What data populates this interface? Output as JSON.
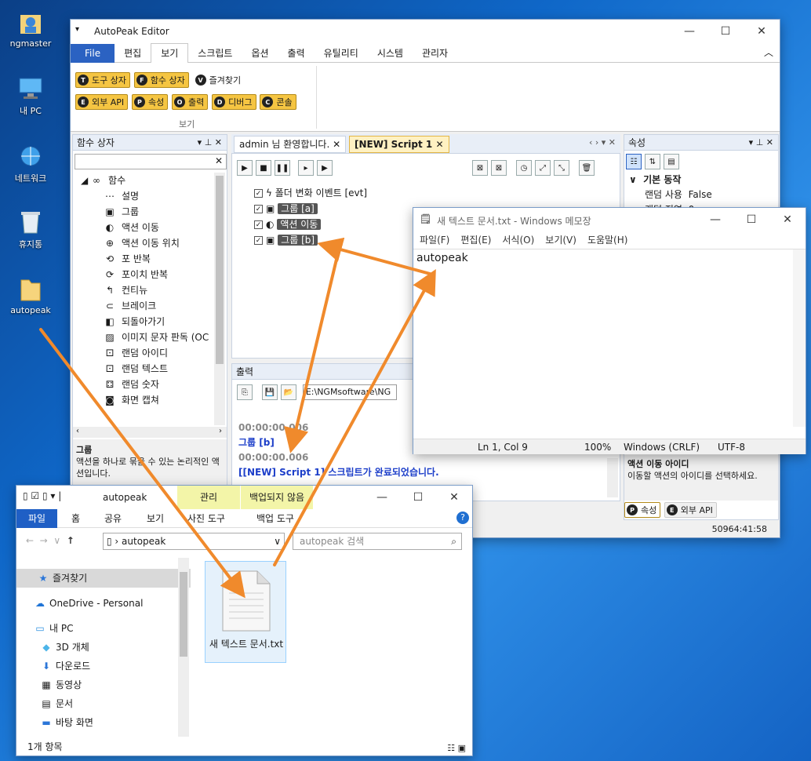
{
  "desktop": {
    "icons": [
      "ngmaster",
      "내 PC",
      "네트워크",
      "휴지통",
      "autopeak"
    ]
  },
  "autopeak": {
    "title": "AutoPeak Editor",
    "menu": [
      "File",
      "편집",
      "보기",
      "스크립트",
      "옵션",
      "출력",
      "유틸리티",
      "시스템",
      "관리자"
    ],
    "ribbon": {
      "row1": [
        {
          "k": "T",
          "t": "도구 상자"
        },
        {
          "k": "F",
          "t": "함수 상자"
        },
        {
          "k": "V",
          "t": "즐겨찾기"
        }
      ],
      "row2": [
        {
          "k": "E",
          "t": "외부 API"
        },
        {
          "k": "P",
          "t": "속성"
        },
        {
          "k": "O",
          "t": "출력"
        },
        {
          "k": "D",
          "t": "디버그"
        },
        {
          "k": "C",
          "t": "콘솔"
        }
      ],
      "group": "보기"
    },
    "func_box": {
      "title": "함수 상자",
      "root": "함수",
      "items": [
        "설명",
        "그룹",
        "액션 이동",
        "액션 이동 위치",
        "포 반복",
        "포이치 반복",
        "컨티뉴",
        "브레이크",
        "되돌아가기",
        "이미지 문자 판독 (OC",
        "랜덤 아이디",
        "랜덤 텍스트",
        "랜덤 숫자",
        "화면 캡쳐"
      ],
      "desc_title": "그룹",
      "desc": "액션을 하나로 묶을 수 있는 논리적인 액션입니다."
    },
    "tabs": [
      "admin 님 환영합니다.",
      "[NEW] Script 1"
    ],
    "script": [
      {
        "t": "폴더 변화 이벤트 [evt]",
        "tag": false
      },
      {
        "t": "그룹 [a]",
        "tag": true
      },
      {
        "t": "액션 이동",
        "tag": true
      },
      {
        "t": "그룹 [b]",
        "tag": true
      }
    ],
    "output": {
      "title": "출력",
      "path": "E:\\NGMsoftware\\NG",
      "lines": [
        "00:00:00.006",
        "그룹 [b]",
        "00:00:00.006",
        "[[NEW] Script 1] 스크립트가 완료되었습니다."
      ]
    },
    "props": {
      "title": "속성",
      "section": "기본 동작",
      "rows": [
        {
          "k": "랜덤 사용",
          "v": "False"
        },
        {
          "k": "랜덤 지연",
          "v": "0"
        }
      ],
      "desc_title": "액션 이동 아이디",
      "desc": "이동할 액션의 아이디를 선택하세요.",
      "tabs": [
        "속성",
        "외부 API"
      ]
    },
    "status": "50964:41:58"
  },
  "notepad": {
    "title": "새 텍스트 문서.txt - Windows 메모장",
    "menu": [
      "파일(F)",
      "편집(E)",
      "서식(O)",
      "보기(V)",
      "도움말(H)"
    ],
    "content": "autopeak",
    "status": [
      "Ln 1, Col 9",
      "100%",
      "Windows (CRLF)",
      "UTF-8"
    ]
  },
  "explorer": {
    "title": "autopeak",
    "ctx_tabs": [
      "관리",
      "백업되지 않음"
    ],
    "ribbon_tabs": [
      "파일",
      "홈",
      "공유",
      "보기",
      "사진 도구",
      "백업 도구"
    ],
    "address": "autopeak",
    "search_placeholder": "autopeak 검색",
    "nav": [
      "즐겨찾기",
      "OneDrive - Personal",
      "내 PC",
      "3D 개체",
      "다운로드",
      "동영상",
      "문서",
      "바탕 화면"
    ],
    "file": "새 텍스트 문서.txt",
    "status": "1개 항목"
  },
  "colors": {
    "accent": "#2b62c2",
    "chip": "#f5c542",
    "arrow": "#f08a2c"
  }
}
